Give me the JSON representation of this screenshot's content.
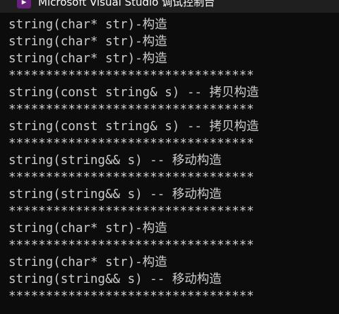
{
  "window": {
    "title": "Microsoft Visual Studio 调试控制台",
    "icon": "visual-studio-icon"
  },
  "colors": {
    "background": "#0c0c0c",
    "text": "#cccccc",
    "titlebar": "#1f1f1f",
    "icon_accent": "#68217a"
  },
  "console": {
    "lines": [
      "string(char* str)-构造",
      "string(char* str)-构造",
      "string(char* str)-构造",
      "*********************************",
      "string(const string& s) -- 拷贝构造",
      "*********************************",
      "string(const string& s) -- 拷贝构造",
      "*********************************",
      "string(string&& s) -- 移动构造",
      "*********************************",
      "string(string&& s) -- 移动构造",
      "*********************************",
      "string(char* str)-构造",
      "*********************************",
      "string(char* str)-构造",
      "string(string&& s) -- 移动构造",
      "*********************************"
    ]
  }
}
